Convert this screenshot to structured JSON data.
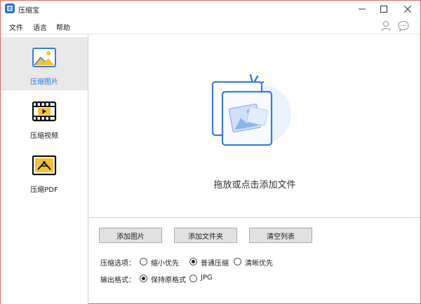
{
  "app": {
    "title": "压缩宝"
  },
  "menu": {
    "file": "文件",
    "language": "语言",
    "help": "帮助"
  },
  "icons": {
    "app": "app-logo-icon",
    "minimize": "minimize-icon",
    "maximize": "maximize-icon",
    "close": "close-icon",
    "user": "user-icon",
    "message": "chat-bubble-icon"
  },
  "sidebar": {
    "items": [
      {
        "label": "压缩图片",
        "icon": "image-icon",
        "active": true
      },
      {
        "label": "压缩视频",
        "icon": "video-icon",
        "active": false
      },
      {
        "label": "压缩PDF",
        "icon": "pdf-icon",
        "active": false
      }
    ]
  },
  "dropzone": {
    "text": "拖放或点击添加文件"
  },
  "buttons": {
    "add_image": "添加图片",
    "add_folder": "添加文件夹",
    "clear_list": "清空列表"
  },
  "options": {
    "compress_label": "压缩选项：",
    "compress_choices": [
      {
        "label": "缩小优先",
        "checked": false
      },
      {
        "label": "普通压缩",
        "checked": true
      },
      {
        "label": "清晰优先",
        "checked": false
      }
    ],
    "format_label": "输出格式：",
    "format_choices": [
      {
        "label": "保持原格式",
        "checked": true
      },
      {
        "label": "JPG",
        "checked": false
      }
    ]
  },
  "colors": {
    "accent": "#2a7ad9",
    "active_bg": "#e9e9e9",
    "window_border": "#d86a6a"
  }
}
